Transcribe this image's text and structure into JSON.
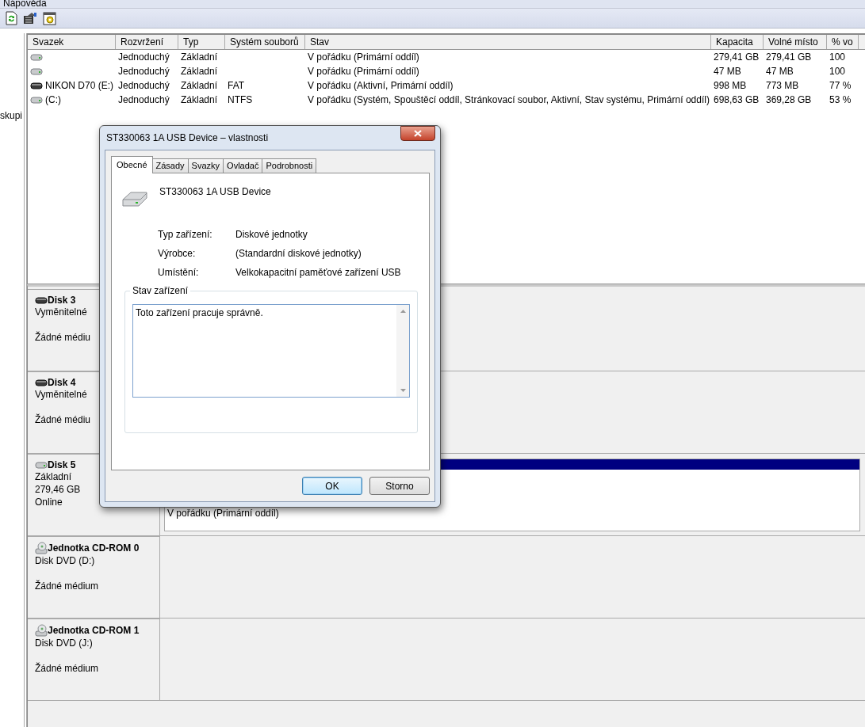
{
  "menu_bar": {
    "items": [
      "Nápověda"
    ]
  },
  "sidebar": {
    "items": [
      "skupi"
    ]
  },
  "volume_table": {
    "columns": [
      "Svazek",
      "Rozvržení",
      "Typ",
      "Systém souborů",
      "Stav",
      "Kapacita",
      "Volné místo",
      "% vo"
    ],
    "rows": [
      {
        "kind": "hdd",
        "cells": [
          "",
          "Jednoduchý",
          "Základní",
          "",
          "V pořádku (Primární oddíl)",
          "279,41 GB",
          "279,41 GB",
          "100"
        ]
      },
      {
        "kind": "hdd",
        "cells": [
          "",
          "Jednoduchý",
          "Základní",
          "",
          "V pořádku (Primární oddíl)",
          "47 MB",
          "47 MB",
          "100"
        ]
      },
      {
        "kind": "removable",
        "cells": [
          "NIKON D70 (E:)",
          "Jednoduchý",
          "Základní",
          "FAT",
          "V pořádku (Aktivní, Primární oddíl)",
          "998 MB",
          "773 MB",
          "77 %"
        ]
      },
      {
        "kind": "hdd",
        "cells": [
          "(C:)",
          "Jednoduchý",
          "Základní",
          "NTFS",
          "V pořádku (Systém, Spouštěcí oddíl, Stránkovací soubor, Aktivní, Stav systému, Primární oddíl)",
          "698,63 GB",
          "369,28 GB",
          "53 %"
        ]
      }
    ]
  },
  "disks": [
    {
      "kind": "removable",
      "name": "Disk 3",
      "description": "Vyměnitelné",
      "status": "Žádné médiu"
    },
    {
      "kind": "removable",
      "name": "Disk 4",
      "description": "Vyměnitelné",
      "status": "Žádné médiu"
    },
    {
      "kind": "hdd",
      "name": "Disk 5",
      "description": "Základní",
      "size": "279,46 GB",
      "status": "Online",
      "partitions": [
        {
          "status": "V pořádku (Primární oddíl)"
        }
      ]
    },
    {
      "kind": "cdrom",
      "name": "Jednotka CD-ROM 0",
      "description": "Disk DVD (D:)",
      "status": "Žádné médium"
    },
    {
      "kind": "cdrom",
      "name": "Jednotka CD-ROM 1",
      "description": "Disk DVD (J:)",
      "status": "Žádné médium"
    }
  ],
  "dialog": {
    "title": "ST330063 1A USB Device – vlastnosti",
    "tabs": [
      {
        "label": "Obecné",
        "selected": true
      },
      {
        "label": "Zásady",
        "selected": false
      },
      {
        "label": "Svazky",
        "selected": false
      },
      {
        "label": "Ovladač",
        "selected": false
      },
      {
        "label": "Podrobnosti",
        "selected": false
      }
    ],
    "device_name": "ST330063 1A USB Device",
    "properties": [
      {
        "label": "Typ zařízení:",
        "value": "Diskové jednotky"
      },
      {
        "label": "Výrobce:",
        "value": "(Standardní diskové jednotky)"
      },
      {
        "label": "Umístění:",
        "value": "Velkokapacitní paměťové zařízení USB"
      }
    ],
    "status_group": {
      "title": "Stav zařízení",
      "text": "Toto zařízení pracuje správně."
    },
    "buttons": [
      {
        "label": "OK",
        "default": true
      },
      {
        "label": "Storno",
        "default": false
      }
    ]
  }
}
